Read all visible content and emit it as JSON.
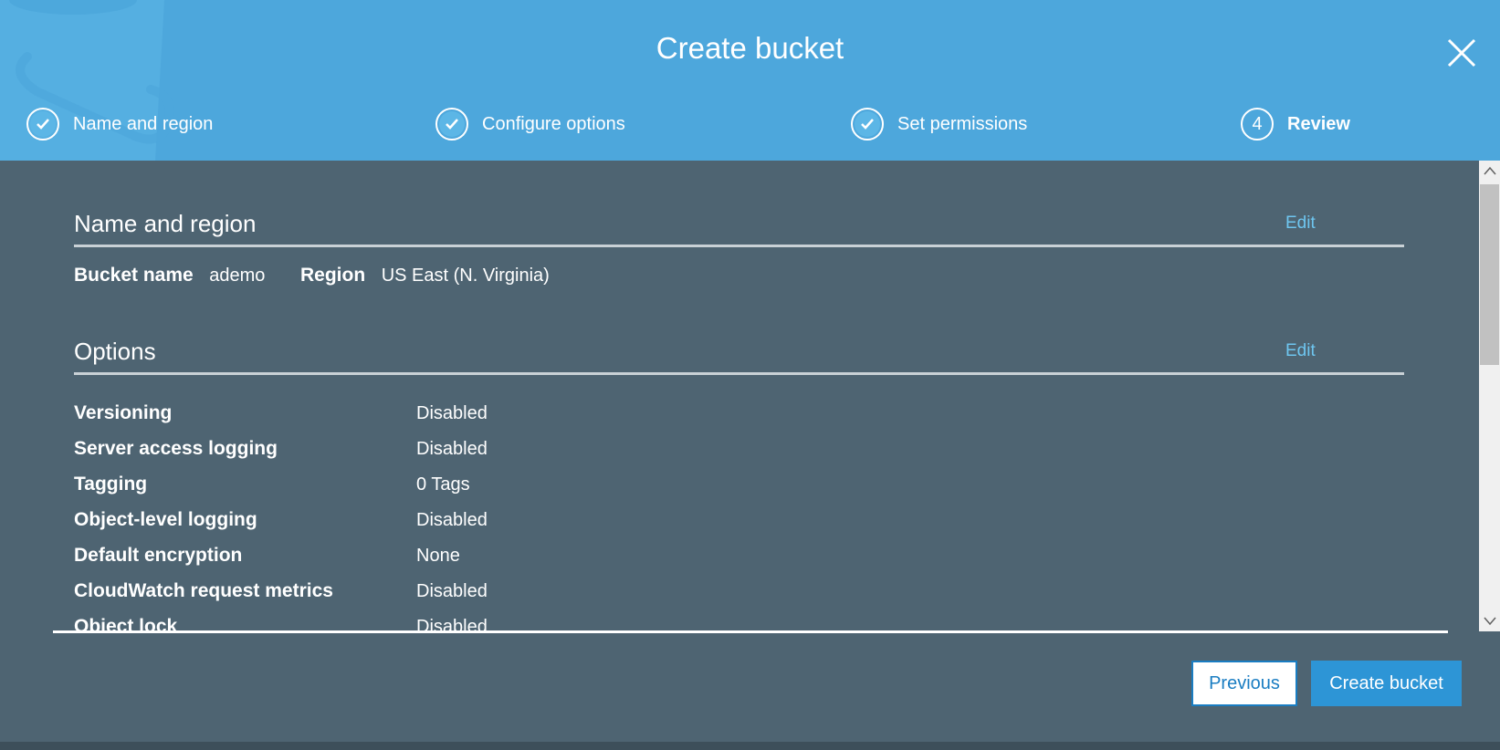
{
  "dialog": {
    "title": "Create bucket"
  },
  "steps": [
    {
      "label": "Name and region",
      "status": "complete"
    },
    {
      "label": "Configure options",
      "status": "complete"
    },
    {
      "label": "Set permissions",
      "status": "complete"
    },
    {
      "label": "Review",
      "number": "4",
      "status": "current"
    }
  ],
  "name_region": {
    "heading": "Name and region",
    "edit_label": "Edit",
    "bucket_name_label": "Bucket name",
    "bucket_name_value": "ademo",
    "region_label": "Region",
    "region_value": "US East (N. Virginia)"
  },
  "options": {
    "heading": "Options",
    "edit_label": "Edit",
    "rows": [
      {
        "label": "Versioning",
        "value": "Disabled"
      },
      {
        "label": "Server access logging",
        "value": "Disabled"
      },
      {
        "label": "Tagging",
        "value": "0 Tags"
      },
      {
        "label": "Object-level logging",
        "value": "Disabled"
      },
      {
        "label": "Default encryption",
        "value": "None"
      },
      {
        "label": "CloudWatch request metrics",
        "value": "Disabled"
      },
      {
        "label": "Object lock",
        "value": "Disabled"
      }
    ]
  },
  "footer": {
    "previous_label": "Previous",
    "create_label": "Create bucket"
  },
  "colors": {
    "header_bg": "#4da7dc",
    "body_bg": "#4e6472",
    "link": "#6ec6f0",
    "primary_button": "#2d95d6"
  },
  "icons": {
    "close": "close-icon",
    "step_done": "check-circle-icon",
    "scroll_up": "chevron-up-icon",
    "scroll_down": "chevron-down-icon"
  }
}
